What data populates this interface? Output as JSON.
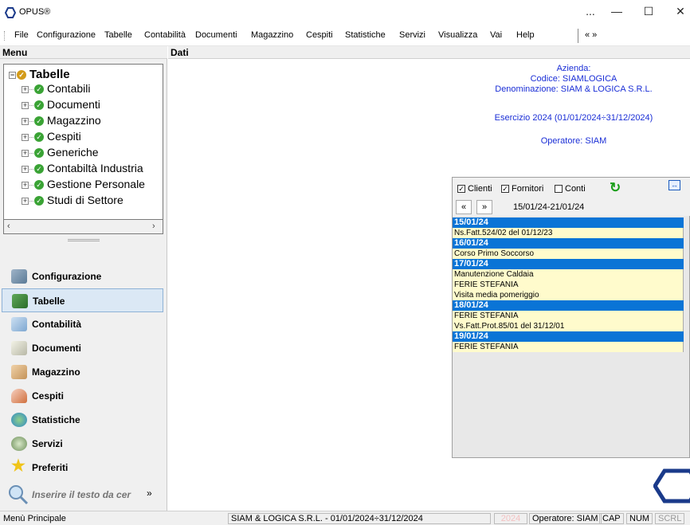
{
  "app": {
    "title": "OPUS®"
  },
  "window_controls": {
    "more": "...",
    "minimize": "—",
    "maximize": "☐",
    "close": "✕"
  },
  "menubar": {
    "items": [
      "File",
      "Configurazione",
      "Tabelle",
      "Contabilità",
      "Documenti",
      "Magazzino",
      "Cespiti",
      "Statistiche",
      "Servizi",
      "Visualizza",
      "Vai",
      "Help"
    ],
    "chevrons": "« »"
  },
  "panels": {
    "left_header": "Menu",
    "right_header": "Dati"
  },
  "tree": {
    "root": "Tabelle",
    "items": [
      "Contabili",
      "Documenti",
      "Magazzino",
      "Cespiti",
      "Generiche",
      "Contabiltà Industria",
      "Gestione Personale",
      "Studi di Settore"
    ]
  },
  "nav": {
    "buttons": [
      "Configurazione",
      "Tabelle",
      "Contabilità",
      "Documenti",
      "Magazzino",
      "Cespiti",
      "Statistiche",
      "Servizi",
      "Preferiti"
    ],
    "active": "Tabelle",
    "search_placeholder": "Inserire il testo da cer"
  },
  "company_info": {
    "azienda": "Azienda:",
    "codice": "Codice: SIAMLOGICA",
    "denominazione": "Denominazione: SIAM & LOGICA S.R.L.",
    "esercizio": "Esercizio 2024 (01/01/2024÷31/12/2024)",
    "operatore": "Operatore: SIAM"
  },
  "agenda": {
    "filters": [
      {
        "label": "Clienti",
        "checked": true
      },
      {
        "label": "Fornitori",
        "checked": true
      },
      {
        "label": "Conti",
        "checked": false
      }
    ],
    "prev": "«",
    "next": "»",
    "range": "15/01/24-21/01/24",
    "entries": [
      {
        "type": "date",
        "text": "15/01/24"
      },
      {
        "type": "evt",
        "text": "Ns.Fatt.524/02 del 01/12/23"
      },
      {
        "type": "date",
        "text": "16/01/24"
      },
      {
        "type": "evt",
        "text": "Corso Primo Soccorso"
      },
      {
        "type": "date",
        "text": "17/01/24"
      },
      {
        "type": "evt",
        "text": "Manutenzione Caldaia"
      },
      {
        "type": "evt",
        "text": "FERIE STEFANIA"
      },
      {
        "type": "evt",
        "text": "Visita media pomeriggio"
      },
      {
        "type": "date",
        "text": "18/01/24"
      },
      {
        "type": "evt",
        "text": "FERIE STEFANIA"
      },
      {
        "type": "evt",
        "text": "Vs.Fatt.Prot.85/01 del 31/12/01"
      },
      {
        "type": "date",
        "text": "19/01/24"
      },
      {
        "type": "evt",
        "text": "FERIE STEFANIA"
      }
    ]
  },
  "statusbar": {
    "left": "Menù Principale",
    "company": "SIAM & LOGICA S.R.L. - 01/01/2024÷31/12/2024",
    "year": "2024",
    "operator": "Operatore: SIAM",
    "cap": "CAP",
    "num": "NUM",
    "scrl": "SCRL"
  },
  "colors": {
    "accent": "#0a74d6",
    "info_text": "#1a2ed6",
    "event_bg": "#fffbcc"
  }
}
